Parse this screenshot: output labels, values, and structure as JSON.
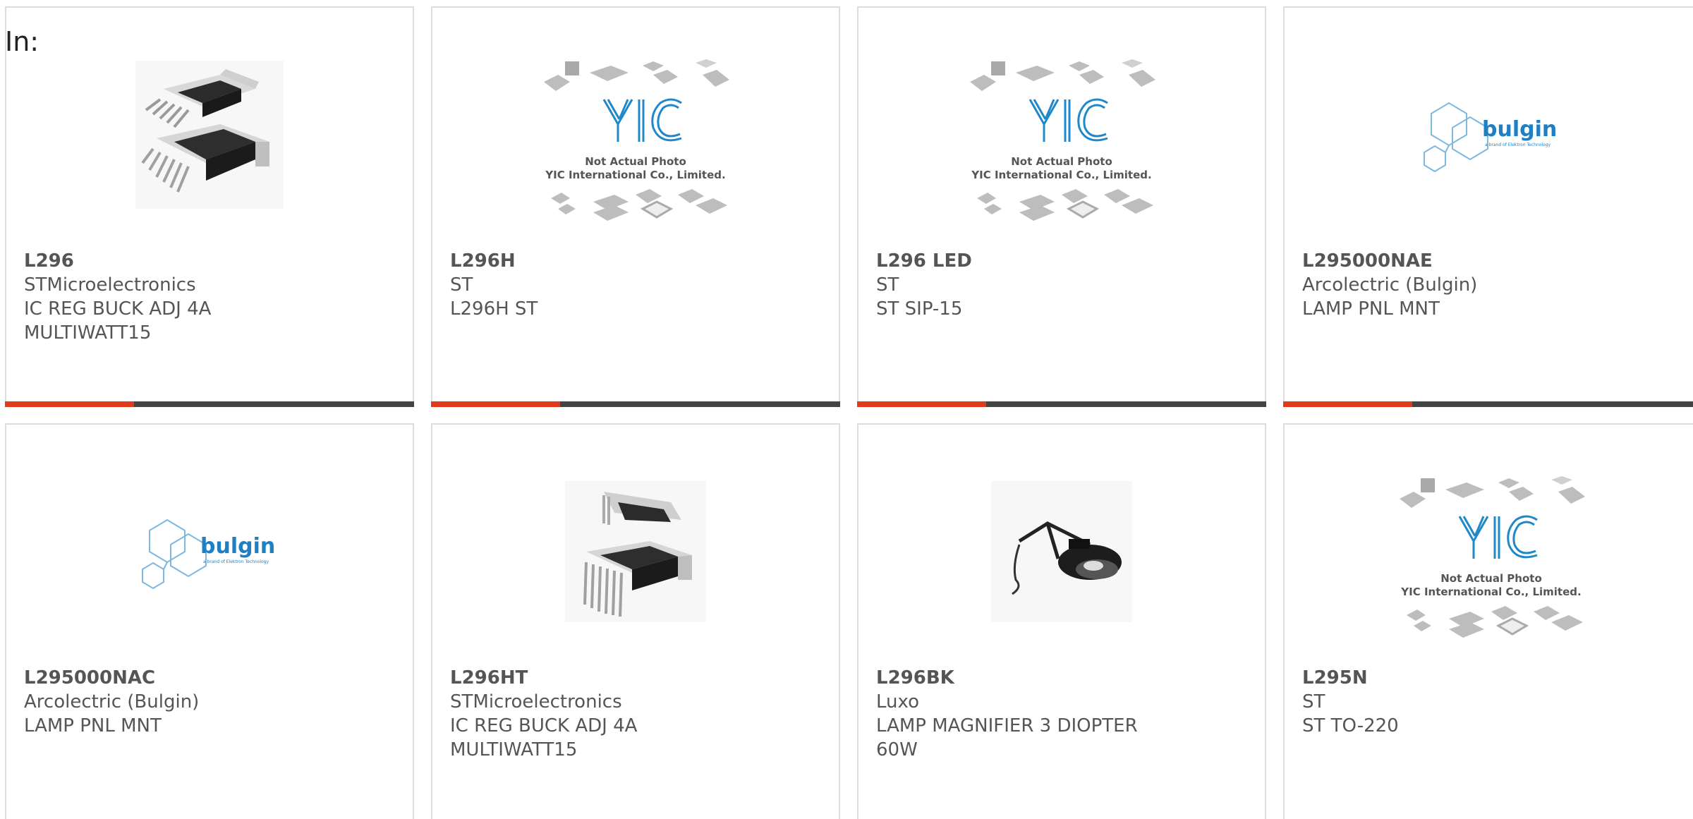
{
  "header": {
    "label": "In:"
  },
  "products": [
    {
      "part": "L296",
      "maker": "STMicroelectronics",
      "desc1": "IC REG BUCK ADJ 4A",
      "desc2": "MULTIWATT15",
      "image": "multiwatt-ic-image"
    },
    {
      "part": "L296H",
      "maker": "ST",
      "desc1": "L296H ST",
      "desc2": "",
      "image": "yic-placeholder-image"
    },
    {
      "part": "L296 LED",
      "maker": "ST",
      "desc1": "ST SIP-15",
      "desc2": "",
      "image": "yic-placeholder-image"
    },
    {
      "part": "L295000NAE",
      "maker": "Arcolectric (Bulgin)",
      "desc1": "LAMP PNL MNT",
      "desc2": "",
      "image": "bulgin-logo-image"
    },
    {
      "part": "L295000NAC",
      "maker": "Arcolectric (Bulgin)",
      "desc1": "LAMP PNL MNT",
      "desc2": "",
      "image": "bulgin-logo-image"
    },
    {
      "part": "L296HT",
      "maker": "STMicroelectronics",
      "desc1": "IC REG BUCK ADJ 4A",
      "desc2": "MULTIWATT15",
      "image": "multiwatt-ic-image"
    },
    {
      "part": "L296BK",
      "maker": "Luxo",
      "desc1": "LAMP MAGNIFIER 3 DIOPTER",
      "desc2": "60W",
      "image": "magnifier-lamp-image"
    },
    {
      "part": "L295N",
      "maker": "ST",
      "desc1": "ST TO-220",
      "desc2": "",
      "image": "yic-placeholder-image"
    }
  ],
  "placeholder": {
    "line1": "Not Actual Photo",
    "line2": "YIC International Co., Limited.",
    "logo": "YIC"
  },
  "bulgin": {
    "word": "bulgin",
    "tagline": "a brand of Elektron Technology"
  },
  "colors": {
    "accent": "#e03a1a",
    "bar": "#444444",
    "text": "#555555",
    "border": "#dddddd",
    "bulgin_blue": "#1f7fc4"
  }
}
